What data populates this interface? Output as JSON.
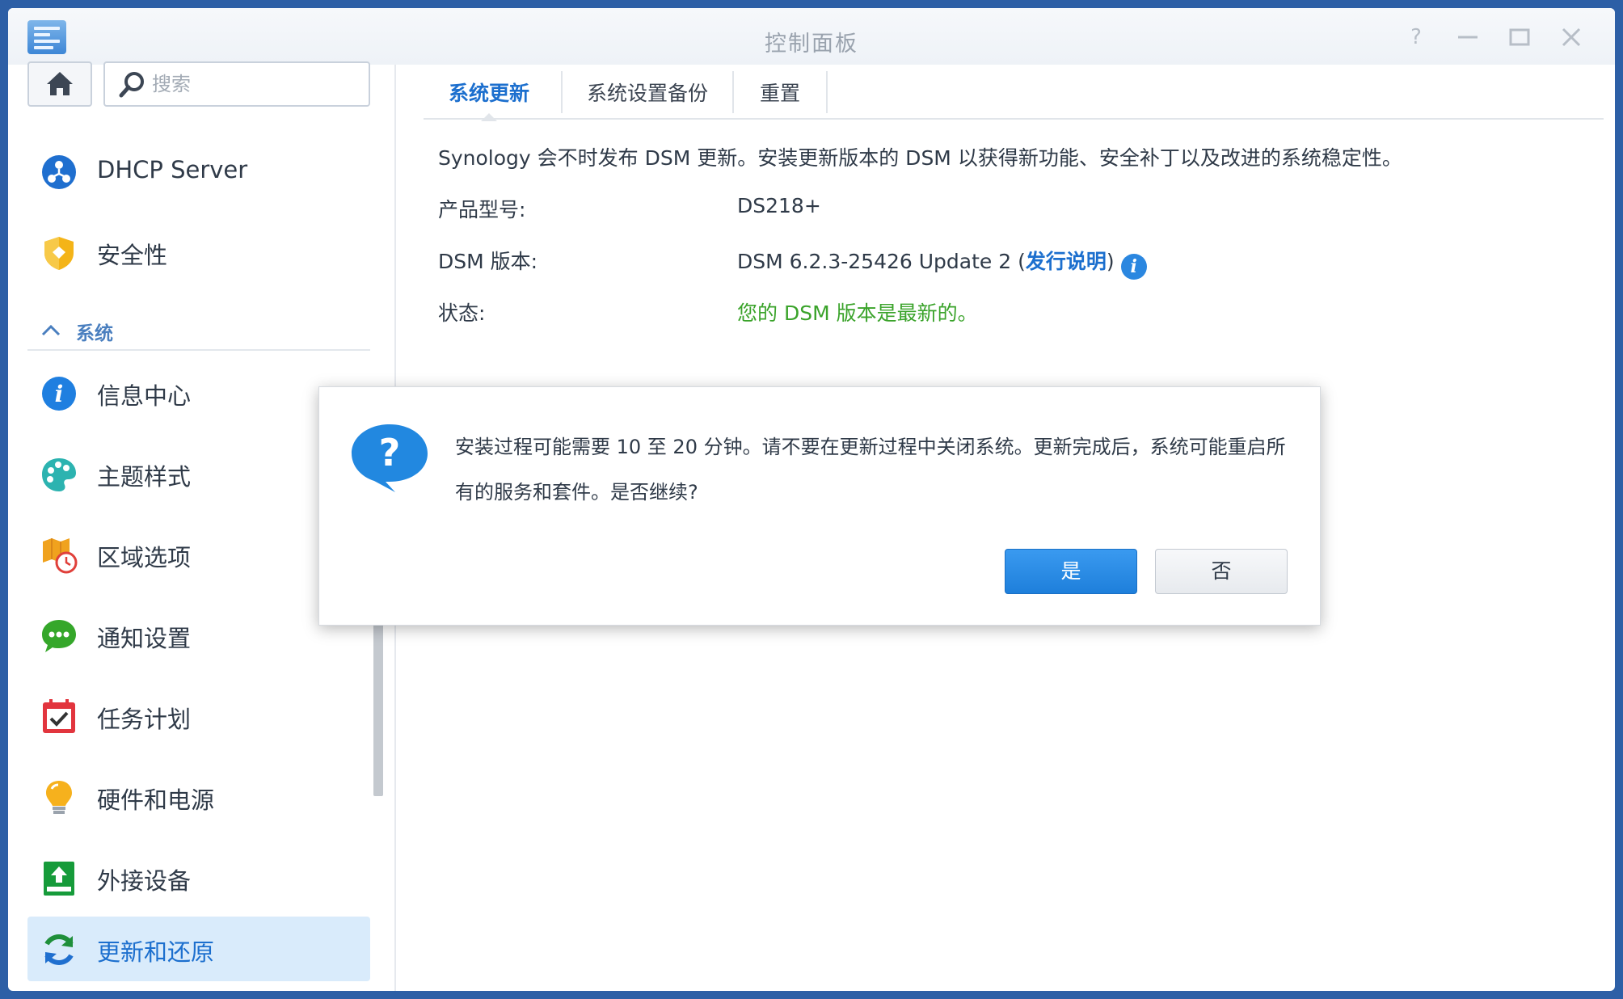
{
  "window": {
    "title": "控制面板"
  },
  "search": {
    "placeholder": "搜索"
  },
  "sidebar": {
    "items_top": [
      {
        "label": "DHCP Server",
        "icon": "dhcp-server-icon"
      },
      {
        "label": "安全性",
        "icon": "shield-icon"
      }
    ],
    "section": {
      "label": "系统",
      "icon": "chevron-up-icon"
    },
    "items": [
      {
        "label": "信息中心",
        "icon": "info-center-icon"
      },
      {
        "label": "主题样式",
        "icon": "palette-icon"
      },
      {
        "label": "区域选项",
        "icon": "regional-options-icon"
      },
      {
        "label": "通知设置",
        "icon": "chat-bubble-icon"
      },
      {
        "label": "任务计划",
        "icon": "calendar-check-icon"
      },
      {
        "label": "硬件和电源",
        "icon": "lightbulb-icon"
      },
      {
        "label": "外接设备",
        "icon": "external-device-icon"
      },
      {
        "label": "更新和还原",
        "icon": "refresh-icon",
        "active": true
      }
    ]
  },
  "tabs": [
    {
      "label": "系统更新",
      "active": true
    },
    {
      "label": "系统设置备份"
    },
    {
      "label": "重置"
    }
  ],
  "main": {
    "description": "Synology 会不时发布 DSM 更新。安装更新版本的 DSM 以获得新功能、安全补丁以及改进的系统稳定性。",
    "rows": {
      "model_label": "产品型号:",
      "model_value": "DS218+",
      "version_label": "DSM 版本:",
      "version_value": "DSM 6.2.3-25426 Update 2 (",
      "release_notes_link": "发行说明",
      "version_close": ")",
      "status_label": "状态:",
      "status_value": "您的 DSM 版本是最新的。"
    }
  },
  "dialog": {
    "message": "安装过程可能需要 10 至 20 分钟。请不要在更新过程中关闭系统。更新完成后，系统可能重启所有的服务和套件。是否继续?",
    "yes_label": "是",
    "no_label": "否"
  },
  "colors": {
    "accent": "#1c6fce",
    "status_ok": "#3aa32a",
    "primary_button": "#1e7fdb",
    "active_item_bg": "#d9ebfb",
    "desktop_bg": "#2d5fa6"
  }
}
